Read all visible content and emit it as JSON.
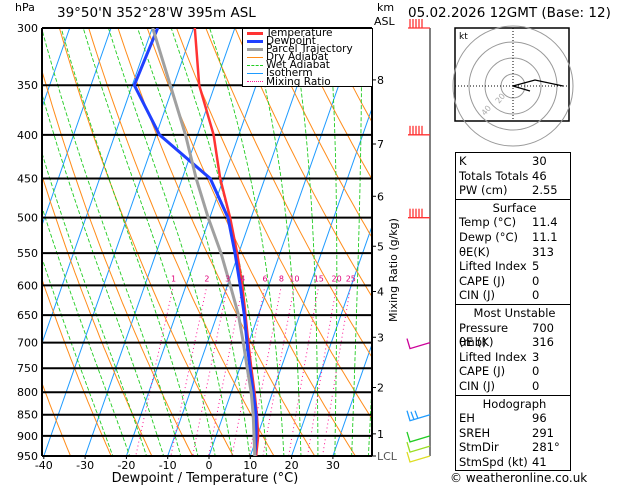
{
  "header": {
    "pressure_unit": "hPa",
    "location": "39°50'N  352°28'W  395m  ASL",
    "km_unit": "km",
    "km_unit2": "ASL",
    "datetime": "05.02.2026  12GMT  (Base: 12)",
    "copyright": "© weatheronline.co.uk"
  },
  "legend": [
    {
      "label": "Temperature",
      "color": "#ff3333",
      "style": "solid"
    },
    {
      "label": "Dewpoint",
      "color": "#2040ff",
      "style": "solid"
    },
    {
      "label": "Parcel Trajectory",
      "color": "#a0a0a0",
      "style": "solid"
    },
    {
      "label": "Dry Adiabat",
      "color": "#ff8c1a",
      "style": "thin"
    },
    {
      "label": "Wet Adiabat",
      "color": "#22cc22",
      "style": "dashed"
    },
    {
      "label": "Isotherm",
      "color": "#1e9bff",
      "style": "thin"
    },
    {
      "label": "Mixing Ratio",
      "color": "#ff1493",
      "style": "dotted"
    }
  ],
  "chart_data": {
    "type": "line",
    "subtype": "skew-t log-p",
    "xlabel": "Dewpoint / Temperature (°C)",
    "ylabel": "hPa",
    "right_axis_label": "Mixing Ratio (g/kg)",
    "xlim": [
      -40,
      40
    ],
    "ylim": [
      950,
      300
    ],
    "y_scale": "log",
    "x_ticks": [
      -40,
      -30,
      -20,
      -10,
      0,
      10,
      20,
      30
    ],
    "pressure_levels": [
      300,
      350,
      400,
      450,
      500,
      550,
      600,
      650,
      700,
      750,
      800,
      850,
      900,
      950
    ],
    "km_ticks": [
      {
        "label": "8",
        "p": 345
      },
      {
        "label": "7",
        "p": 410
      },
      {
        "label": "6",
        "p": 472
      },
      {
        "label": "5",
        "p": 540
      },
      {
        "label": "4",
        "p": 610
      },
      {
        "label": "3",
        "p": 690
      },
      {
        "label": "2",
        "p": 790
      },
      {
        "label": "1",
        "p": 895
      },
      {
        "label": "LCL",
        "p": 950
      }
    ],
    "mixing_ratio_labels": [
      "1",
      "2",
      "3",
      "4",
      "6",
      "8",
      "10",
      "15",
      "20",
      "25"
    ],
    "mixing_ratio_label_pressure": 600,
    "series": [
      {
        "name": "Temperature",
        "color": "#ff3333",
        "p": [
          300,
          350,
          400,
          450,
          500,
          550,
          600,
          650,
          700,
          750,
          800,
          850,
          900,
          950
        ],
        "t": [
          -39.7,
          -33.8,
          -26.1,
          -20.8,
          -15.1,
          -10.4,
          -6.4,
          -3.1,
          -0.1,
          2.8,
          5.6,
          8.1,
          10.2,
          11.4
        ]
      },
      {
        "name": "Dewpoint",
        "color": "#2040ff",
        "p": [
          300,
          350,
          400,
          450,
          500,
          550,
          600,
          650,
          700,
          750,
          800,
          850,
          900,
          950
        ],
        "t": [
          -48.7,
          -49.5,
          -39.2,
          -23.2,
          -15.6,
          -10.9,
          -6.9,
          -3.4,
          -0.4,
          2.5,
          5.3,
          7.9,
          9.7,
          11.1
        ]
      },
      {
        "name": "Parcel Trajectory",
        "color": "#a0a0a0",
        "p": [
          300,
          350,
          400,
          450,
          500,
          550,
          600,
          650,
          700,
          750,
          800,
          850,
          900,
          950
        ],
        "t": [
          -49.9,
          -40.8,
          -32.9,
          -26.6,
          -20.4,
          -14.3,
          -9.3,
          -4.8,
          -1.3,
          1.8,
          4.8,
          7.2,
          9.2,
          11.1
        ]
      }
    ],
    "wind_barbs": [
      {
        "p": 300,
        "color": "#ff3333"
      },
      {
        "p": 400,
        "color": "#ff3333"
      },
      {
        "p": 500,
        "color": "#ff3333"
      },
      {
        "p": 700,
        "color": "#cc0099"
      },
      {
        "p": 850,
        "color": "#1e9bff"
      },
      {
        "p": 900,
        "color": "#22cc22"
      },
      {
        "p": 925,
        "color": "#99dd22"
      },
      {
        "p": 950,
        "color": "#dddd22"
      }
    ],
    "grid": true,
    "legend_placement": "top-right"
  },
  "hodograph": {
    "unit": "kt",
    "ring_labels": [
      "20",
      "40"
    ]
  },
  "stats": {
    "indices": [
      {
        "k": "K",
        "v": "30"
      },
      {
        "k": "Totals Totals",
        "v": "46"
      },
      {
        "k": "PW (cm)",
        "v": "2.55"
      }
    ],
    "surface": {
      "title": "Surface",
      "rows": [
        {
          "k": "Temp (°C)",
          "v": "11.4"
        },
        {
          "k": "Dewp (°C)",
          "v": "11.1"
        },
        {
          "k": "θE(K)",
          "v": "313"
        },
        {
          "k": "Lifted Index",
          "v": "5"
        },
        {
          "k": "CAPE (J)",
          "v": "0"
        },
        {
          "k": "CIN (J)",
          "v": "0"
        }
      ]
    },
    "most_unstable": {
      "title": "Most Unstable",
      "rows": [
        {
          "k": "Pressure (mb)",
          "v": "700"
        },
        {
          "k": "θE (K)",
          "v": "316"
        },
        {
          "k": "Lifted Index",
          "v": "3"
        },
        {
          "k": "CAPE (J)",
          "v": "0"
        },
        {
          "k": "CIN (J)",
          "v": "0"
        }
      ]
    },
    "hodograph": {
      "title": "Hodograph",
      "rows": [
        {
          "k": "EH",
          "v": "96"
        },
        {
          "k": "SREH",
          "v": "291"
        },
        {
          "k": "StmDir",
          "v": "281°"
        },
        {
          "k": "StmSpd (kt)",
          "v": "41"
        }
      ]
    }
  }
}
